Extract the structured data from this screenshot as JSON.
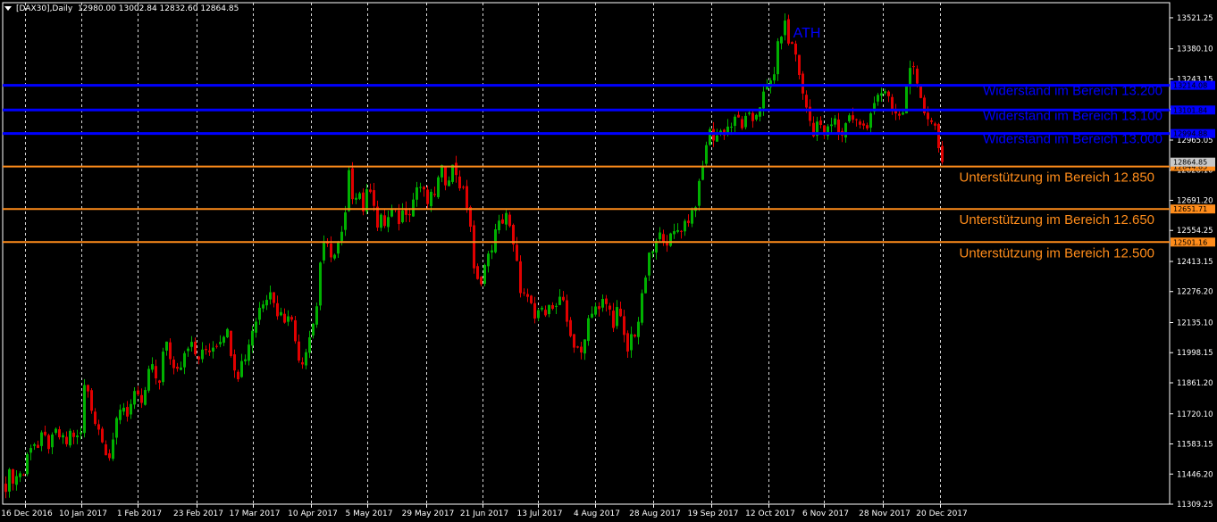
{
  "header": {
    "symbol": "[DAX30],Daily",
    "ohlc": "12980.00 13002.84 12832.60 12864.85"
  },
  "colors": {
    "background": "#000000",
    "axis": "#ffffff",
    "grid": "#ffffff",
    "bull": "#00b000",
    "bear": "#e00000",
    "resistance": "#0000ff",
    "support": "#ff8c1a"
  },
  "chart_data": {
    "type": "candlestick",
    "title": "[DAX30],Daily",
    "ylim": [
      11309.25,
      13590.0
    ],
    "y_ticks": [
      "13521.25",
      "13380.10",
      "13243.15",
      "13106.20",
      "12965.05",
      "12828.10",
      "12691.20",
      "12554.25",
      "12413.15",
      "12276.20",
      "12135.10",
      "11998.15",
      "11861.20",
      "11720.10",
      "11583.15",
      "11446.20",
      "11309.25"
    ],
    "x_tick_labels": [
      "16 Dec 2016",
      "10 Jan 2017",
      "1 Feb 2017",
      "23 Feb 2017",
      "17 Mar 2017",
      "10 Apr 2017",
      "5 May 2017",
      "29 May 2017",
      "21 Jun 2017",
      "13 Jul 2017",
      "4 Aug 2017",
      "28 Aug 2017",
      "19 Sep 2017",
      "12 Oct 2017",
      "6 Nov 2017",
      "28 Nov 2017",
      "20 Dec 2017"
    ],
    "grid": "vertical dashed",
    "price_path": [
      11400,
      11450,
      11420,
      11460,
      11440,
      11580,
      11600,
      11560,
      11620,
      11580,
      11590,
      11640,
      11600,
      11580,
      11640,
      11620,
      11580,
      11850,
      11820,
      11700,
      11650,
      11620,
      11510,
      11550,
      11700,
      11780,
      11720,
      11760,
      11800,
      11760,
      11800,
      11940,
      11900,
      11860,
      12000,
      12040,
      11920,
      11950,
      11960,
      12050,
      12030,
      11980,
      11970,
      12010,
      12020,
      12040,
      12060,
      12100,
      12080,
      11970,
      11900,
      11960,
      12000,
      12100,
      12150,
      12220,
      12260,
      12300,
      12200,
      12180,
      12150,
      12200,
      12100,
      12000,
      11960,
      12050,
      12100,
      12200,
      12450,
      12480,
      12460,
      12440,
      12500,
      12560,
      12800,
      12700,
      12760,
      12650,
      12720,
      12780,
      12560,
      12600,
      12580,
      12640,
      12620,
      12600,
      12660,
      12650,
      12700,
      12780,
      12720,
      12680,
      12700,
      12760,
      12820,
      12780,
      12840,
      12830,
      12760,
      12700,
      12640,
      12360,
      12300,
      12380,
      12420,
      12500,
      12560,
      12600,
      12640,
      12520,
      12420,
      12300,
      12240,
      12220,
      12140,
      12200,
      12160,
      12260,
      12180,
      12220,
      12230,
      12140,
      12080,
      12000,
      11980,
      12100,
      12180,
      12220,
      12180,
      12240,
      12200,
      12140,
      12200,
      12100,
      11990,
      12080,
      12100,
      12200,
      12350,
      12440,
      12480,
      12520,
      12540,
      12500,
      12530,
      12560,
      12580,
      12600,
      12640,
      12700,
      12780,
      12950,
      13000,
      12980,
      13000,
      13010,
      13030,
      13040,
      13060,
      13030,
      13060,
      13050,
      13100,
      13150,
      13180,
      13230,
      13300,
      13450,
      13490,
      13400,
      13390,
      13300,
      13150,
      13100,
      13000,
      13050,
      13000,
      12990,
      13030,
      13050,
      12980,
      13020,
      13100,
      13050,
      13050,
      13020,
      13000,
      13150,
      13180,
      13190,
      13160,
      13100,
      13080,
      13050,
      13150,
      13330,
      13250,
      13150,
      13100,
      13080,
      13050,
      12990,
      12864.85
    ],
    "candle_count": 263,
    "annotations": [
      {
        "label": "ATH",
        "color": "#0000ff"
      }
    ],
    "levels": [
      {
        "name": "resistance-13200",
        "price": 13214.08,
        "price_label": "13214.08",
        "label": "Widerstand im Bereich 13.200",
        "color": "#0000ff"
      },
      {
        "name": "resistance-13100",
        "price": 13101.84,
        "price_label": "13101.84",
        "label": "Widerstand im Bereich 13.100",
        "color": "#0000ff"
      },
      {
        "name": "resistance-13000",
        "price": 12994.88,
        "price_label": "12994.88",
        "label": "Widerstand im Bereich 13.000",
        "color": "#0000ff"
      },
      {
        "name": "support-12850",
        "price": 12844.85,
        "price_label": "12844.85",
        "label": "Unterstützung im Bereich 12.850",
        "color": "#ff8c1a"
      },
      {
        "name": "support-12650",
        "price": 12651.71,
        "price_label": "12651.71",
        "label": "Unterstützung im Bereich 12.650",
        "color": "#ff8c1a"
      },
      {
        "name": "support-12500",
        "price": 12501.16,
        "price_label": "12501.16",
        "label": "Unterstützung im Bereich 12.500",
        "color": "#ff8c1a"
      }
    ],
    "current_price": "12864.85"
  }
}
